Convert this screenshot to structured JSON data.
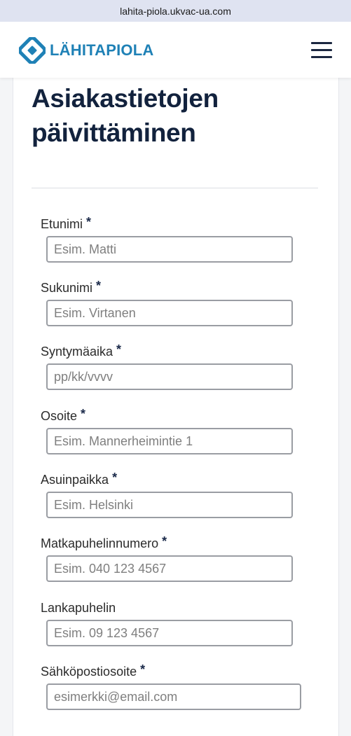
{
  "browser": {
    "url": "lahita-piola.ukvac-ua.com"
  },
  "header": {
    "brand": "LÄHITAPIOLA",
    "menu_icon": "hamburger-menu-icon",
    "brand_color": "#1f81b6"
  },
  "page": {
    "title_line1": "Asiakastietojen",
    "title_line2": "päivittäminen"
  },
  "form": {
    "required_marker": "*",
    "fields": [
      {
        "label": "Etunimi",
        "required": true,
        "placeholder": "Esim. Matti"
      },
      {
        "label": "Sukunimi",
        "required": true,
        "placeholder": "Esim. Virtanen"
      },
      {
        "label": "Syntymäaika",
        "required": true,
        "placeholder": "pp/kk/vvvv"
      },
      {
        "label": "Osoite",
        "required": true,
        "placeholder": "Esim. Mannerheimintie 1"
      },
      {
        "label": "Asuinpaikka",
        "required": true,
        "placeholder": "Esim. Helsinki"
      },
      {
        "label": "Matkapuhelinnumero",
        "required": true,
        "placeholder": "Esim. 040 123 4567"
      },
      {
        "label": "Lankapuhelin",
        "required": false,
        "placeholder": "Esim. 09 123 4567"
      },
      {
        "label": "Sähköpostiosoite",
        "required": true,
        "placeholder": "esimerkki@email.com"
      }
    ]
  }
}
